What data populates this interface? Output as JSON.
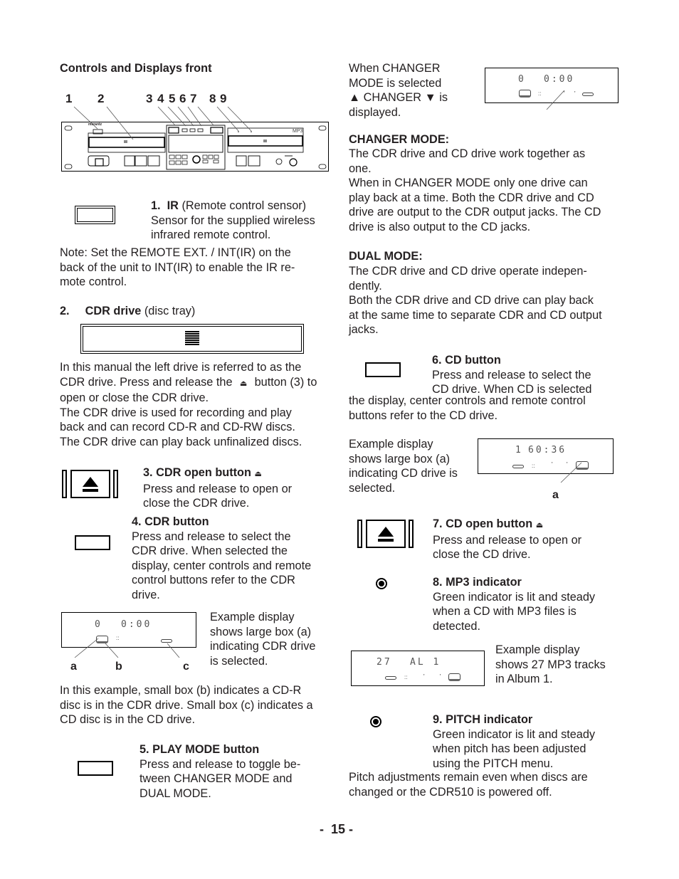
{
  "section_title": "Controls and Displays front",
  "panel_numbers": [
    "1",
    "2",
    "3",
    "4",
    "5",
    "6",
    "7",
    "8",
    "9"
  ],
  "panel": {
    "brand": "marantz",
    "mp3_label": "MP3"
  },
  "items": {
    "ir": {
      "number": "1.",
      "title": "IR",
      "subtitle": "(Remote control sensor)",
      "body": "Sensor for the supplied wireless\ninfrared remote control.",
      "note": "Note: Set the REMOTE EXT. / INT(IR) on the\nback of the unit to INT(IR) to enable the IR re-\nmote control."
    },
    "cdr_drive": {
      "number": "2.",
      "title": "CDR drive",
      "subtitle": "(disc tray)",
      "body_1a": "In this manual the left drive is referred to as the\nCDR drive. Press and release the",
      "body_1b": "button (3) to",
      "body_1c": "open or close the CDR drive.",
      "body_2": "The CDR drive is used for recording and play\nback and can record CD-R and CD-RW discs.\nThe CDR drive can play back unfinalized discs."
    },
    "cdr_open": {
      "title": "3.   CDR open button",
      "body": "Press and release to open or\nclose the CDR drive."
    },
    "cdr_button": {
      "title": "4.   CDR button",
      "body": "Press and release to select the\nCDR drive. When selected the\ndisplay, center controls and remote\ncontrol buttons refer to the CDR\ndrive.",
      "example": "Example display\nshows large box (a)\nindicating CDR drive\nis selected.",
      "display_track": "0",
      "display_time": "0:00",
      "callouts": [
        "a",
        "b",
        "c"
      ],
      "after": "In this example, small box (b) indicates a CD-R\ndisc is in the CDR drive. Small box (c) indicates a\nCD disc is in the CD drive."
    },
    "play_mode": {
      "title": "5.   PLAY MODE button",
      "body": "Press and release to toggle be-\ntween CHANGER MODE and\nDUAL MODE."
    },
    "changer": {
      "intro_1": "When CHANGER\nMODE is selected",
      "intro_2": "▲ CHANGER ▼ is",
      "intro_3": "displayed.",
      "display_track": "0",
      "display_time": "0:00",
      "heading": "CHANGER MODE:",
      "body": "The CDR drive and CD drive work together as\none.\nWhen in CHANGER MODE only one drive can\nplay back at a time. Both the CDR drive and CD\ndrive are output to the CDR output jacks. The CD\ndrive is also output to the CD jacks."
    },
    "dual": {
      "heading": "DUAL MODE:",
      "body": "The CDR drive and CD drive operate indepen-\ndently.\nBoth the CDR drive and CD drive can play back\nat the same time to separate CDR and CD output\njacks."
    },
    "cd_button": {
      "title": "6.  CD button",
      "body_a": "Press and release to select the\nCD drive. When CD is selected",
      "body_b": "the display, center controls and remote control\nbuttons refer to the CD drive.",
      "example": "Example display\nshows large box (a)\nindicating CD drive is\nselected.",
      "display_track": "1",
      "display_time": "60:36",
      "callout": "a"
    },
    "cd_open": {
      "title": "7.   CD open button",
      "body": "Press and release to open or\nclose the CD drive."
    },
    "mp3": {
      "title": "8.  MP3 indicator",
      "body": "Green indicator is lit and steady\nwhen a CD with MP3 files is\ndetected.",
      "display_tracks": "27",
      "display_album": "AL  1",
      "example": "Example display\nshows 27 MP3 tracks\nin Album 1."
    },
    "pitch": {
      "title": "9.  PITCH indicator",
      "body": "Green indicator is lit and steady\nwhen pitch has been adjusted\nusing the PITCH menu.",
      "after": "Pitch adjustments remain even when discs are\nchanged or the CDR510 is powered off."
    }
  },
  "page_number": "-  15 -"
}
